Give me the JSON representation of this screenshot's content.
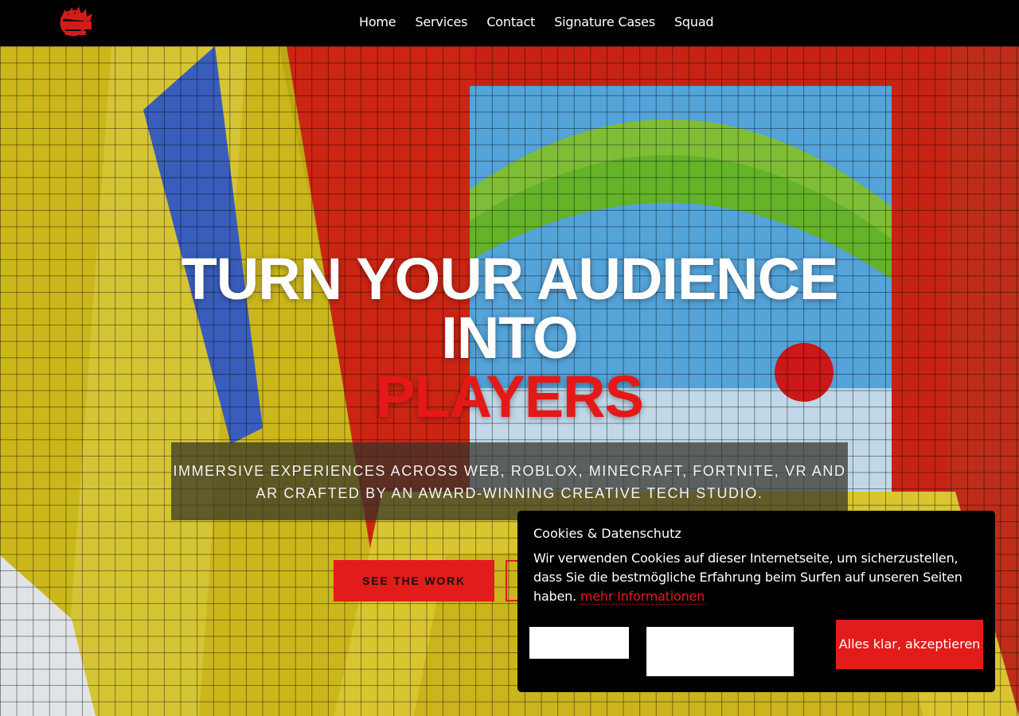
{
  "nav": {
    "logo_alt": "Event Forge logo",
    "items": [
      "Home",
      "Services",
      "Contact",
      "Signature Cases",
      "Squad"
    ]
  },
  "hero": {
    "headline_line1": "TURN YOUR AUDIENCE",
    "headline_line2": "INTO",
    "headline_accent": "PLAYERS",
    "subtitle": "IMMERSIVE EXPERIENCES ACROSS WEB, ROBLOX, MINECRAFT, FORTNITE, VR AND AR CRAFTED BY AN AWARD-WINNING CREATIVE TECH STUDIO.",
    "cta_label": "SEE THE WORK"
  },
  "cookie": {
    "title": "Cookies & Datenschutz",
    "text": "Wir verwenden Cookies auf dieser Internetseite, um sicherzustellen, dass Sie die bestmögliche Erfahrung beim Surfen auf unseren Seiten haben.",
    "link": "mehr Informationen",
    "accept_label": "Alles klar, akzeptieren"
  },
  "colors": {
    "accent": "#e21b1b",
    "nav_bg": "#000000",
    "text": "#ffffff"
  }
}
